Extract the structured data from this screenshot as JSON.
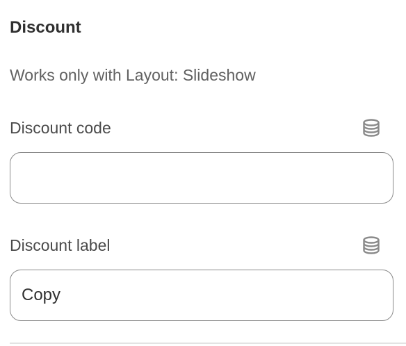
{
  "section": {
    "title": "Discount",
    "helper": "Works only with Layout: Slideshow"
  },
  "fields": {
    "discount_code": {
      "label": "Discount code",
      "value": "",
      "icon": "database-icon"
    },
    "discount_label": {
      "label": "Discount label",
      "value": "Copy",
      "icon": "database-icon"
    }
  },
  "colors": {
    "text_primary": "#303030",
    "text_secondary": "#616161",
    "input_border": "#8a8a8a",
    "icon": "#8a8a8a"
  }
}
